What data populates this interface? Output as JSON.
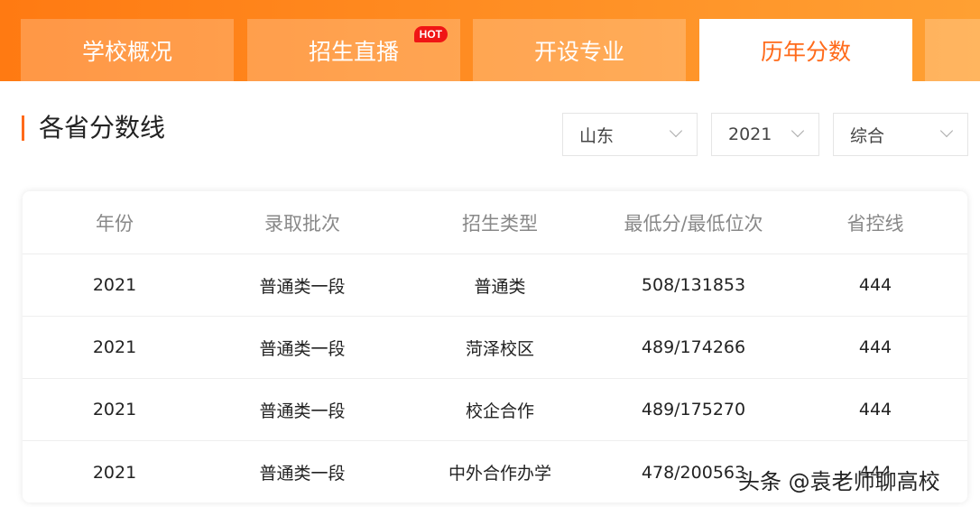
{
  "tabs": [
    {
      "label": "学校概况"
    },
    {
      "label": "招生直播",
      "badge": "HOT"
    },
    {
      "label": "开设专业"
    },
    {
      "label": "历年分数"
    }
  ],
  "section": {
    "title": "各省分数线"
  },
  "filters": {
    "province": "山东",
    "year": "2021",
    "type": "综合"
  },
  "table": {
    "headers": [
      "年份",
      "录取批次",
      "招生类型",
      "最低分/最低位次",
      "省控线"
    ],
    "rows": [
      [
        "2021",
        "普通类一段",
        "普通类",
        "508/131853",
        "444"
      ],
      [
        "2021",
        "普通类一段",
        "菏泽校区",
        "489/174266",
        "444"
      ],
      [
        "2021",
        "普通类一段",
        "校企合作",
        "489/175270",
        "444"
      ],
      [
        "2021",
        "普通类一段",
        "中外合作办学",
        "478/200563",
        "444"
      ]
    ]
  },
  "watermark": "头条 @袁老师聊高校",
  "colors": {
    "accent": "#ff6a1a",
    "hot": "#f01515"
  }
}
